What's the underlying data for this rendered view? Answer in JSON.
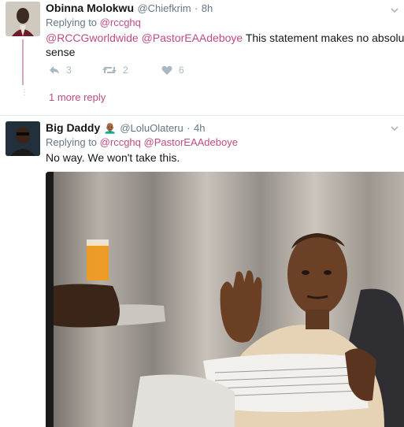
{
  "tweet1": {
    "name": "Obinna Molokwu",
    "handle": "@Chiefkrim",
    "dot": "·",
    "time": "8h",
    "replying_prefix": "Replying to",
    "replying_to": "@rccghq",
    "mention1": "@RCCGworldwide",
    "mention2": "@PastorEAAdeboye",
    "text_line1": "This statement makes no absolute",
    "text_line2": "sense",
    "reply_count": "3",
    "retweet_count": "2",
    "like_count": "6",
    "more_replies": "1 more reply"
  },
  "tweet2": {
    "name": "Big Daddy",
    "emoji": "👨🏾‍🦲",
    "handle": "@LoluOlateru",
    "dot": "·",
    "time": "4h",
    "replying_prefix": "Replying to",
    "replying_to": "@rccghq",
    "mention2": "@PastorEAAdeboye",
    "text": "No way. We won't take this."
  },
  "colors": {
    "mention": "#c04a84",
    "muted": "#657786",
    "action": "#aab8c2"
  },
  "icons": {
    "reply": "reply-icon",
    "retweet": "retweet-icon",
    "like": "heart-icon",
    "caret": "chevron-down-icon"
  }
}
